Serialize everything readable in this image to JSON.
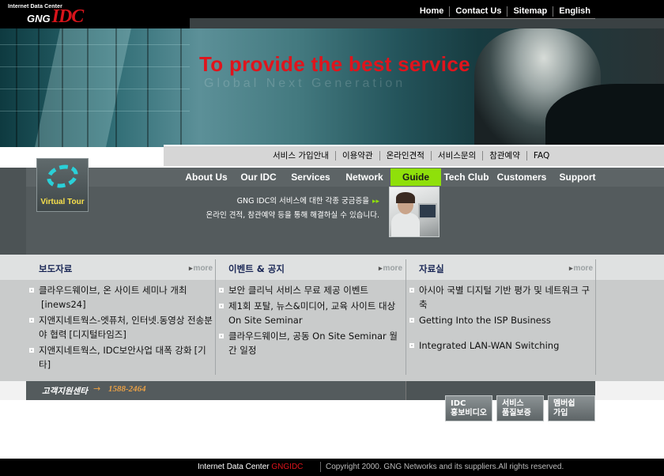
{
  "logo": {
    "subtitle": "Internet Data Center",
    "brand_left": "GNG",
    "brand_right": "IDC"
  },
  "top_nav": [
    "Home",
    "Contact Us",
    "Sitemap",
    "English"
  ],
  "hero": {
    "slogan": "To provide the best service",
    "watermark": "Global Next Generation"
  },
  "menu1": [
    "서비스 가입안내",
    "이용약관",
    "온라인견적",
    "서비스문의",
    "참관예약",
    "FAQ"
  ],
  "menu2": [
    "About Us",
    "Our IDC",
    "Services",
    "Network",
    "Guide",
    "Tech Club",
    "Customers",
    "Support"
  ],
  "menu2_active": "Guide",
  "virtual_tour": {
    "label": "Virtual Tour"
  },
  "guide_info": {
    "line1": "GNG IDC의 서비스에 대한 각종 궁금증을",
    "line2": "온라인 견적, 참관예약 등을 통해 해결하실 수 있습니다."
  },
  "columns": [
    {
      "title": "보도자료",
      "more": "more",
      "items": [
        {
          "text": "클라우드웨이브, 온 사이트 세미나 개최",
          "source": "[inews24]"
        },
        {
          "text": "지앤지네트웍스-엣퓨처, 인터넷.동영상 전송분야 협력",
          "source": "[디지털타임즈]"
        },
        {
          "text": "지앤지네트웍스, IDC보안사업 대폭 강화",
          "source": "[기타]"
        }
      ]
    },
    {
      "title": "이벤트 & 공지",
      "more": "more",
      "items": [
        {
          "text": "보안 클리닉 서비스 무료 제공 이벤트"
        },
        {
          "text": "제1회 포탈, 뉴스&미디어, 교육 사이트 대상 On Site Seminar"
        },
        {
          "text": "클라우드웨이브, 공동 On Site Seminar 월간 일정"
        }
      ]
    },
    {
      "title": "자료실",
      "more": "more",
      "items": [
        {
          "text": "아시아 국별 디지털 기반 평가 및 네트워크 구축"
        },
        {
          "text": "Getting Into the ISP Business"
        },
        {
          "text": "Integrated LAN-WAN Switching"
        }
      ]
    }
  ],
  "customer_center": {
    "label": "고객지원센타",
    "arrow": "→",
    "phone": "1588-2464"
  },
  "quick_buttons": [
    {
      "line1": "IDC",
      "line2": "홍보비디오"
    },
    {
      "line1": "서비스",
      "line2": "품질보증"
    },
    {
      "line1": "멤버쉽",
      "line2": "가입"
    }
  ],
  "footer": {
    "left": "Internet Data Center",
    "brand": "GNGIDC",
    "right": "Copyright 2000. GNG Networks and its suppliers.All rights reserved."
  },
  "colors": {
    "accent_red": "#e0141c",
    "guide_green": "#8fe00a",
    "title_navy": "#1d2a58"
  }
}
